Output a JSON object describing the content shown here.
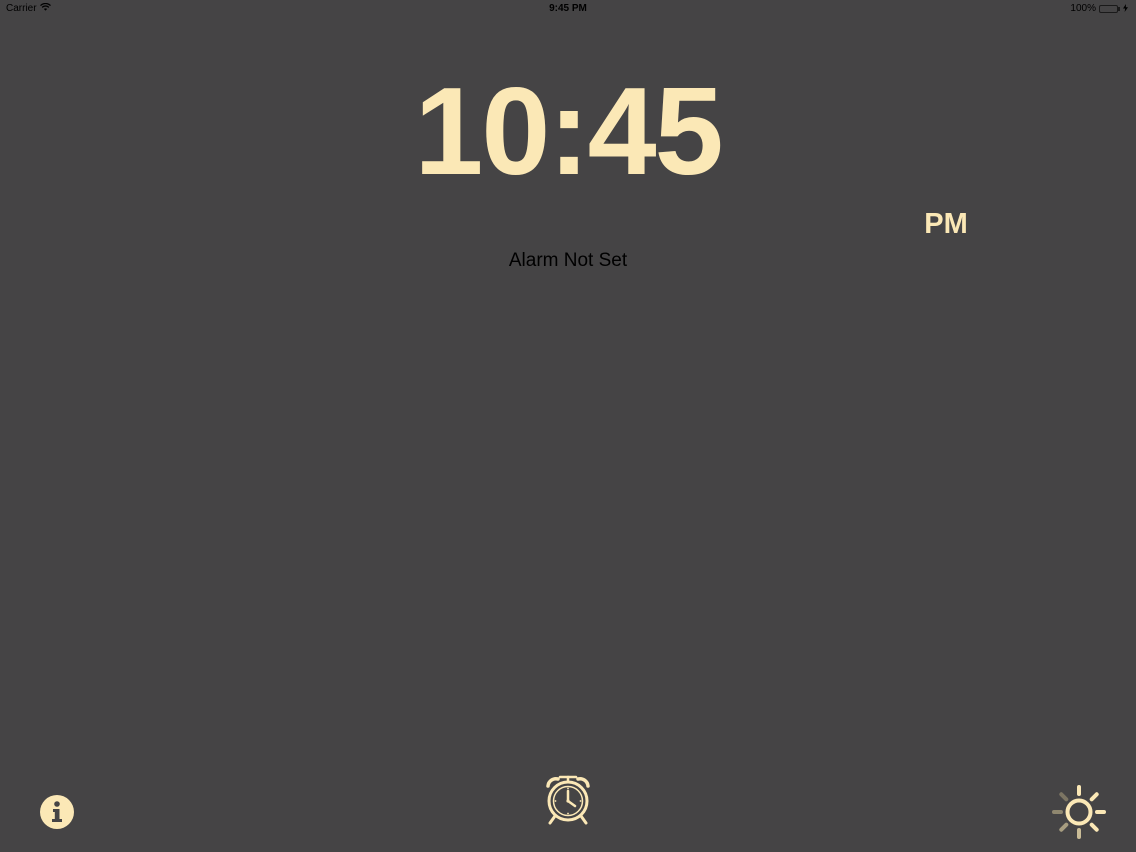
{
  "status_bar": {
    "carrier": "Carrier",
    "time": "9:45 PM",
    "battery_percent": "100%",
    "battery_level": 1.0,
    "battery_color": "#4cd964",
    "icons": [
      "wifi-icon",
      "battery-icon",
      "charging-icon"
    ]
  },
  "clock": {
    "time": "10:45",
    "period": "PM",
    "color": "#fbe8b6"
  },
  "alarm": {
    "status": "Alarm Not Set"
  },
  "toolbar": {
    "info_icon": "info-icon",
    "alarm_icon": "alarm-clock-icon",
    "brightness_icon": "sun-icon"
  },
  "theme": {
    "background": "#454445",
    "accent": "#fbe8b6"
  }
}
